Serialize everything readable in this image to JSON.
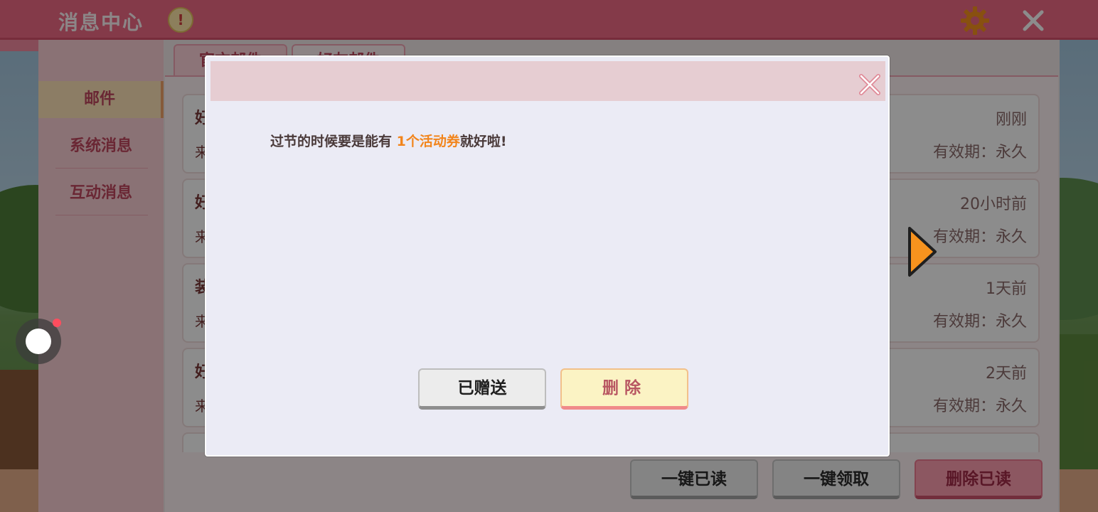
{
  "window": {
    "title": "消息中心",
    "title_badge": "!",
    "icons": {
      "settings": "gear-icon",
      "close": "close-icon"
    }
  },
  "sidebar": {
    "items": [
      {
        "label": "邮件",
        "active": true
      },
      {
        "label": "系统消息",
        "active": false
      },
      {
        "label": "互动消息",
        "active": false
      }
    ]
  },
  "tabs": [
    {
      "label": "官方邮件"
    },
    {
      "label": "好友邮件"
    }
  ],
  "mail_list": [
    {
      "title": "好",
      "from": "来",
      "time": "刚刚",
      "expiry": "有效期：永久"
    },
    {
      "title": "好",
      "from": "来",
      "time": "20小时前",
      "expiry": "有效期：永久"
    },
    {
      "title": "装",
      "from": "来",
      "time": "1天前",
      "expiry": "有效期：永久"
    },
    {
      "title": "好",
      "from": "来",
      "time": "2天前",
      "expiry": "有效期：永久"
    }
  ],
  "bottom_actions": {
    "read_all": "一键已读",
    "claim_all": "一键领取",
    "delete_read": "删除已读"
  },
  "dialog": {
    "message_before": "过节的时候要是能有 ",
    "message_highlight": "1个活动券",
    "message_after": "就好啦!",
    "sent_button": "已赠送",
    "delete_button": "删除"
  },
  "colors": {
    "title_bar": "#f06a86",
    "highlight": "#f2851c",
    "next_arrow": "#f7931e"
  }
}
